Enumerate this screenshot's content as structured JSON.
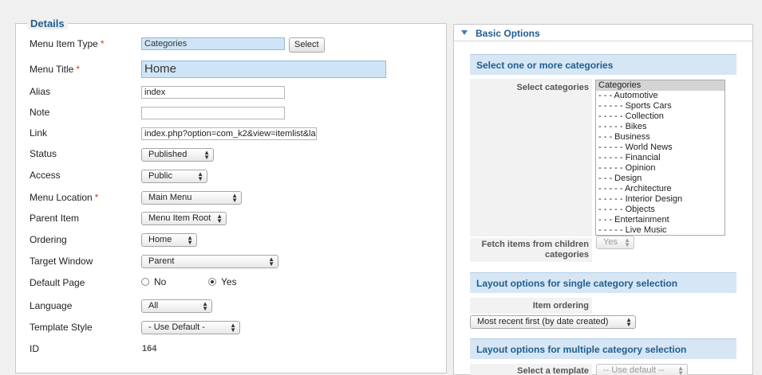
{
  "details": {
    "legend": "Details",
    "menu_item_type": {
      "label": "Menu Item Type",
      "required": "*",
      "value": "Categories",
      "button": "Select"
    },
    "menu_title": {
      "label": "Menu Title",
      "required": "*",
      "value": "Home"
    },
    "alias": {
      "label": "Alias",
      "value": "index"
    },
    "note": {
      "label": "Note",
      "value": ""
    },
    "link": {
      "label": "Link",
      "value": "index.php?option=com_k2&view=itemlist&la"
    },
    "status": {
      "label": "Status",
      "value": "Published"
    },
    "access": {
      "label": "Access",
      "value": "Public"
    },
    "menu_location": {
      "label": "Menu Location",
      "required": "*",
      "value": "Main Menu"
    },
    "parent_item": {
      "label": "Parent Item",
      "value": "Menu Item Root"
    },
    "ordering": {
      "label": "Ordering",
      "value": "Home"
    },
    "target_window": {
      "label": "Target Window",
      "value": "Parent"
    },
    "default_page": {
      "label": "Default Page",
      "no": "No",
      "yes": "Yes",
      "selected": "Yes"
    },
    "language": {
      "label": "Language",
      "value": "All"
    },
    "template_style": {
      "label": "Template Style",
      "value": "- Use Default -"
    },
    "id": {
      "label": "ID",
      "value": "164"
    }
  },
  "basic_options": {
    "title": "Basic Options",
    "section1": "Select one or more categories",
    "select_categories_label": "Select categories",
    "categories": [
      "Categories",
      "- - - Automotive",
      "- - - - - Sports Cars",
      "- - - - - Collection",
      "- - - - - Bikes",
      "- - - Business",
      "- - - - - World News",
      "- - - - - Financial",
      "- - - - - Opinion",
      "- - - Design",
      "- - - - - Architecture",
      "- - - - - Interior Design",
      "- - - - - Objects",
      "- - - Entertainment",
      "- - - - - Live Music"
    ],
    "fetch_children_label": "Fetch items from children categories",
    "fetch_children_value": "Yes",
    "section2": "Layout options for single category selection",
    "item_ordering_label": "Item ordering",
    "item_ordering_value": "Most recent first (by date created)",
    "section3": "Layout options for multiple category selection",
    "select_template_label": "Select a template",
    "select_template_value": "-- Use default --"
  }
}
